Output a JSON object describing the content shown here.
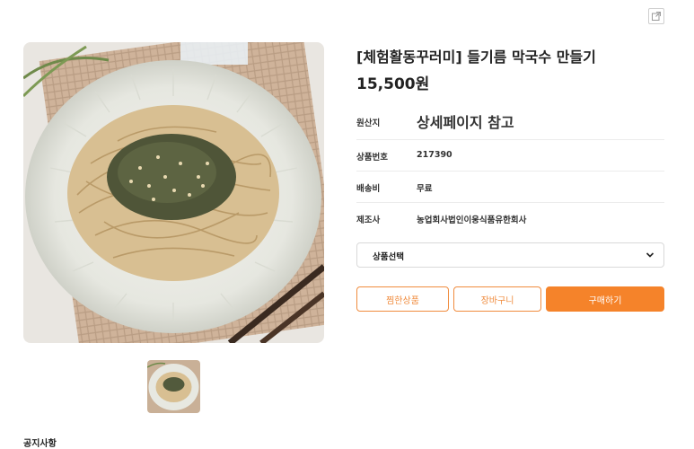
{
  "product": {
    "title": "[체험활동꾸러미] 들기름 막국수 만들기",
    "price": "15,500원",
    "image_alt": "들기름 막국수",
    "info": [
      {
        "label": "원산지",
        "value": "상세페이지 참고"
      },
      {
        "label": "상품번호",
        "value": "217390"
      },
      {
        "label": "배송비",
        "value": "무료"
      },
      {
        "label": "제조사",
        "value": "농업회사법인이웅식품유한회사"
      }
    ]
  },
  "option_select": {
    "label": "상품선택"
  },
  "buttons": {
    "wishlist": "찜한상품",
    "cart": "장바구니",
    "buy": "구매하기"
  },
  "notice": {
    "heading": "공지사항"
  },
  "icons": {
    "share": "share-external-icon",
    "chevron": "chevron-down-icon"
  },
  "colors": {
    "accent": "#f5832a",
    "accent_outline": "#f08c3e"
  }
}
